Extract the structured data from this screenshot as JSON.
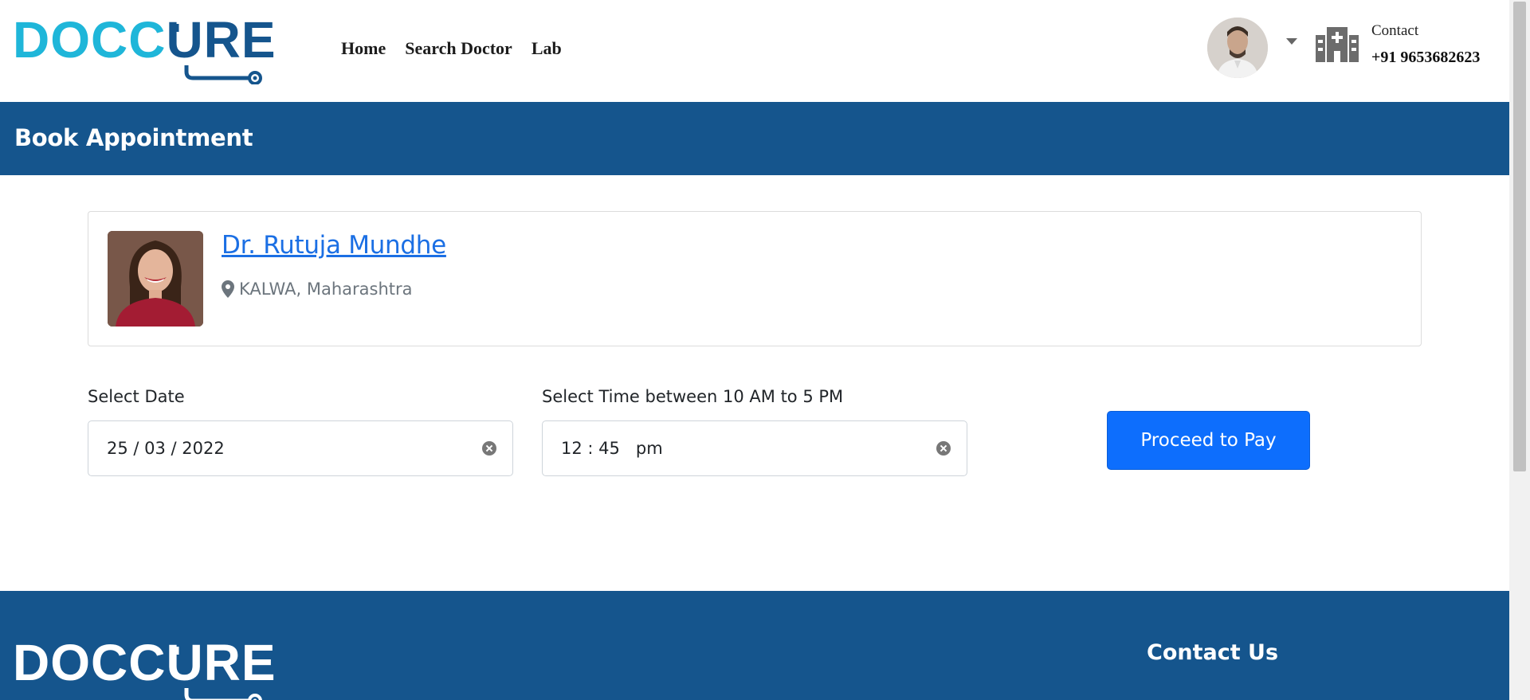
{
  "header": {
    "logo_left": "DOCC",
    "logo_right": "URE",
    "nav": [
      "Home",
      "Search Doctor",
      "Lab"
    ],
    "contact_label": "Contact",
    "contact_phone": "+91 9653682623"
  },
  "banner": {
    "title": "Book Appointment"
  },
  "doctor": {
    "name": "Dr. Rutuja Mundhe",
    "location": "KALWA, Maharashtra"
  },
  "form": {
    "date_label": "Select Date",
    "date_value": "25 / 03 / 2022",
    "time_label": "Select Time between 10 AM to 5 PM",
    "time_value": "12 : 45   pm",
    "submit_label": "Proceed to Pay"
  },
  "footer": {
    "logo_left": "DOCC",
    "logo_right": "URE",
    "contact_heading": "Contact Us"
  },
  "colors": {
    "brand_dark": "#15558d",
    "brand_light": "#1fb6d9",
    "primary_button": "#0d6efd",
    "link": "#1b6fe4"
  }
}
